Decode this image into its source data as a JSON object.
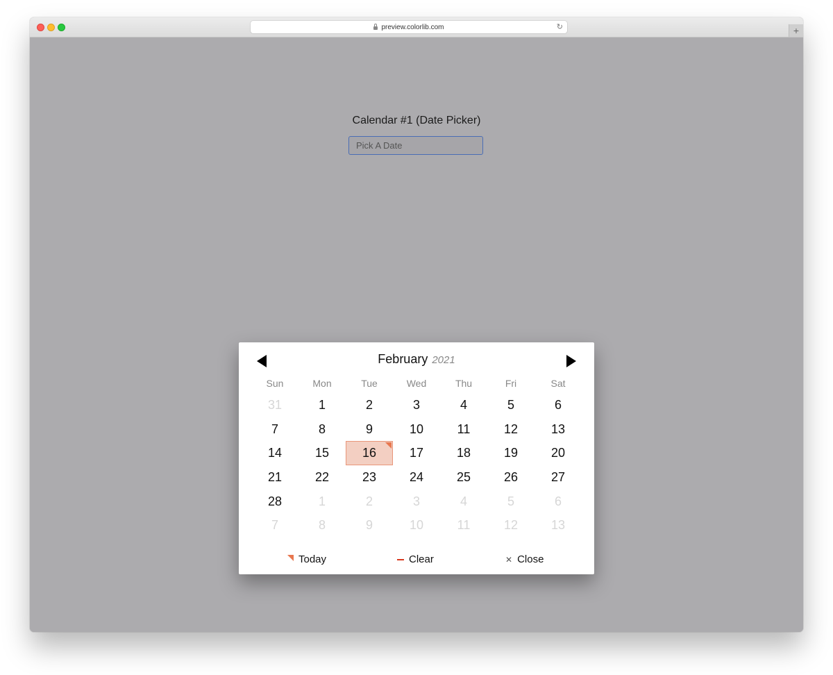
{
  "browser": {
    "url": "preview.colorlib.com",
    "reload_icon": "reload-icon",
    "newtab_label": "+"
  },
  "page": {
    "title": "Calendar #1 (Date Picker)",
    "input_placeholder": "Pick A Date"
  },
  "calendar": {
    "month": "February",
    "year": "2021",
    "weekdays": [
      "Sun",
      "Mon",
      "Tue",
      "Wed",
      "Thu",
      "Fri",
      "Sat"
    ],
    "today": 16,
    "days": [
      {
        "d": "31",
        "muted": true
      },
      {
        "d": "1"
      },
      {
        "d": "2"
      },
      {
        "d": "3"
      },
      {
        "d": "4"
      },
      {
        "d": "5"
      },
      {
        "d": "6"
      },
      {
        "d": "7"
      },
      {
        "d": "8"
      },
      {
        "d": "9"
      },
      {
        "d": "10"
      },
      {
        "d": "11"
      },
      {
        "d": "12"
      },
      {
        "d": "13"
      },
      {
        "d": "14"
      },
      {
        "d": "15"
      },
      {
        "d": "16",
        "today": true
      },
      {
        "d": "17"
      },
      {
        "d": "18"
      },
      {
        "d": "19"
      },
      {
        "d": "20"
      },
      {
        "d": "21"
      },
      {
        "d": "22"
      },
      {
        "d": "23"
      },
      {
        "d": "24"
      },
      {
        "d": "25"
      },
      {
        "d": "26"
      },
      {
        "d": "27"
      },
      {
        "d": "28"
      },
      {
        "d": "1",
        "muted": true
      },
      {
        "d": "2",
        "muted": true
      },
      {
        "d": "3",
        "muted": true
      },
      {
        "d": "4",
        "muted": true
      },
      {
        "d": "5",
        "muted": true
      },
      {
        "d": "6",
        "muted": true
      },
      {
        "d": "7",
        "muted": true
      },
      {
        "d": "8",
        "muted": true
      },
      {
        "d": "9",
        "muted": true
      },
      {
        "d": "10",
        "muted": true
      },
      {
        "d": "11",
        "muted": true
      },
      {
        "d": "12",
        "muted": true
      },
      {
        "d": "13",
        "muted": true
      }
    ],
    "footer": {
      "today_label": "Today",
      "clear_label": "Clear",
      "close_label": "Close"
    }
  },
  "colors": {
    "accent": "#e8774f",
    "today_bg": "#f3cfc2",
    "clear": "#d9381e",
    "overlay": "#acabae"
  }
}
